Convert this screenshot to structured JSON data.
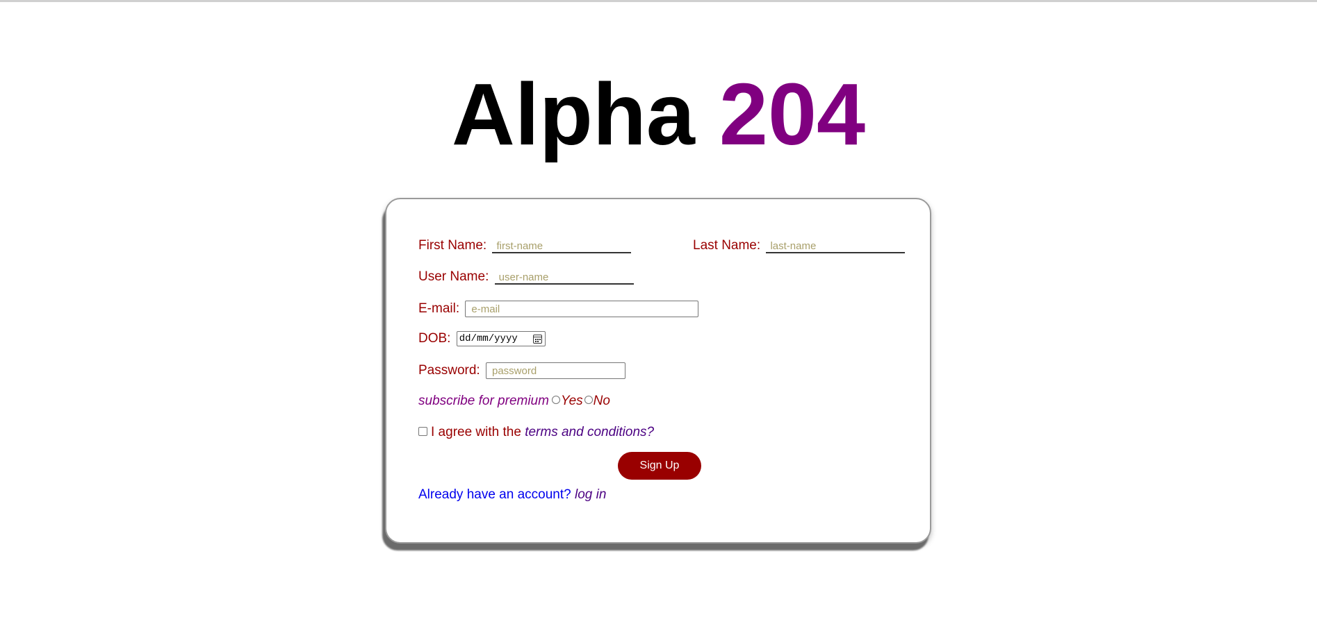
{
  "title": {
    "word1": "Alpha",
    "word2": "204"
  },
  "form": {
    "first_name": {
      "label": "First Name:",
      "placeholder": "first-name"
    },
    "last_name": {
      "label": "Last Name:",
      "placeholder": "last-name"
    },
    "user_name": {
      "label": "User Name:",
      "placeholder": "user-name"
    },
    "email": {
      "label": "E-mail:",
      "placeholder": "e-mail"
    },
    "dob": {
      "label": "DOB:",
      "format_text": "dd/mm/yyyy",
      "icon": "calendar-icon"
    },
    "password": {
      "label": "Password:",
      "placeholder": "password"
    },
    "subscribe": {
      "label": "subscribe for premium",
      "options": [
        "Yes",
        "No"
      ]
    },
    "terms": {
      "prefix": "I agree with the",
      "link": "terms and conditions?"
    },
    "signup_label": "Sign Up",
    "login": {
      "prefix": "Already have an account?",
      "link": "log in"
    }
  },
  "colors": {
    "accent_red": "#990000",
    "accent_purple": "#800080",
    "link_blue": "#0000ee",
    "placeholder": "#a89f6a"
  }
}
